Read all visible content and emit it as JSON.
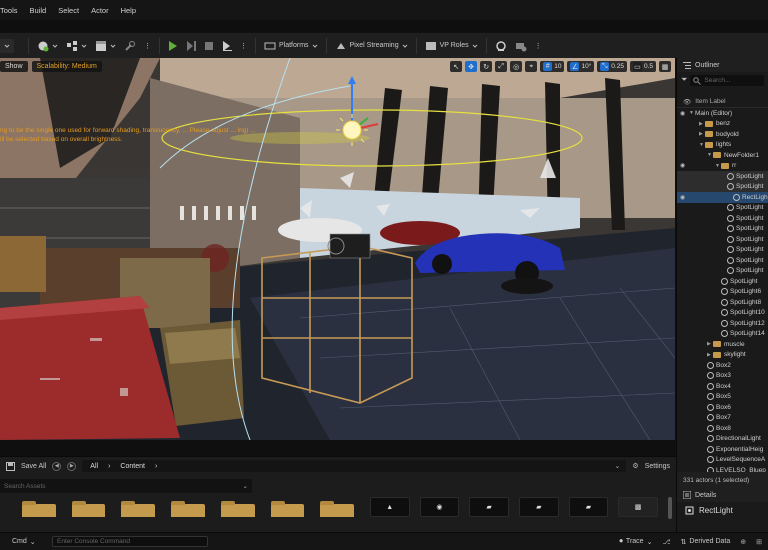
{
  "menu": [
    "Tools",
    "Build",
    "Select",
    "Actor",
    "Help"
  ],
  "toolbar": {
    "platforms": "Platforms",
    "pixel_streaming": "Pixel Streaming",
    "vp_roles": "VP Roles"
  },
  "viewport": {
    "show": "Show",
    "scalability": "Scalability: Medium",
    "warning_line1": "ng to be the single one used for forward shading, translucency, ... Please adjust ... ing) ...",
    "warning_line2": "ill be selected based on overall brightness.",
    "grid_size": "10",
    "rotation_snap": "10°",
    "scale_snap": "0.25",
    "camera_speed": "0.5"
  },
  "outliner": {
    "title": "Outliner",
    "search_placeholder": "Search...",
    "header": "Item Label",
    "rows": [
      {
        "label": "Main (Editor)",
        "indent": 12,
        "kind": "map"
      },
      {
        "label": "benz",
        "indent": 22,
        "kind": "folder"
      },
      {
        "label": "bodyold",
        "indent": 22,
        "kind": "folder"
      },
      {
        "label": "lights",
        "indent": 22,
        "kind": "folder-open"
      },
      {
        "label": "NewFolder1",
        "indent": 30,
        "kind": "folder-open"
      },
      {
        "label": "rr",
        "indent": 38,
        "kind": "folder-open"
      },
      {
        "label": "SpotLight",
        "indent": 50,
        "kind": "light"
      },
      {
        "label": "SpotLight",
        "indent": 50,
        "kind": "light"
      },
      {
        "label": "RectLigh",
        "indent": 56,
        "kind": "light"
      },
      {
        "label": "SpotLight",
        "indent": 50,
        "kind": "light"
      },
      {
        "label": "SpotLight",
        "indent": 50,
        "kind": "light"
      },
      {
        "label": "SpotLight",
        "indent": 50,
        "kind": "light"
      },
      {
        "label": "SpotLight",
        "indent": 50,
        "kind": "light"
      },
      {
        "label": "SpotLight",
        "indent": 50,
        "kind": "light"
      },
      {
        "label": "SpotLight",
        "indent": 50,
        "kind": "light"
      },
      {
        "label": "SpotLight",
        "indent": 50,
        "kind": "light"
      },
      {
        "label": "SpotLight",
        "indent": 44,
        "kind": "light"
      },
      {
        "label": "SpotLight6",
        "indent": 44,
        "kind": "light"
      },
      {
        "label": "SpotLight8",
        "indent": 44,
        "kind": "light"
      },
      {
        "label": "SpotLight10",
        "indent": 44,
        "kind": "light"
      },
      {
        "label": "SpotLight12",
        "indent": 44,
        "kind": "light"
      },
      {
        "label": "SpotLight14",
        "indent": 44,
        "kind": "light"
      },
      {
        "label": "muscle",
        "indent": 30,
        "kind": "folder"
      },
      {
        "label": "skylight",
        "indent": 30,
        "kind": "folder"
      },
      {
        "label": "Box2",
        "indent": 30,
        "kind": "box"
      },
      {
        "label": "Box3",
        "indent": 30,
        "kind": "box"
      },
      {
        "label": "Box4",
        "indent": 30,
        "kind": "box"
      },
      {
        "label": "Box5",
        "indent": 30,
        "kind": "box"
      },
      {
        "label": "Box6",
        "indent": 30,
        "kind": "box"
      },
      {
        "label": "Box7",
        "indent": 30,
        "kind": "box"
      },
      {
        "label": "Box8",
        "indent": 30,
        "kind": "box"
      },
      {
        "label": "DirectionalLight",
        "indent": 30,
        "kind": "light"
      },
      {
        "label": "ExponentialHeig",
        "indent": 30,
        "kind": "box"
      },
      {
        "label": "LevelSequenceA",
        "indent": 30,
        "kind": "box"
      },
      {
        "label": "LEVELSQ_Bluep",
        "indent": 30,
        "kind": "box"
      }
    ],
    "footer": "331 actors (1 selected)"
  },
  "details": {
    "title": "Details",
    "object": "RectLight"
  },
  "content_browser": {
    "save_all": "Save All",
    "path_all": "All",
    "path_content": "Content",
    "settings": "Settings",
    "search_placeholder": "Search Assets"
  },
  "statusbar": {
    "cmd": "Cmd",
    "console_placeholder": "Enter Console Command",
    "trace": "Trace",
    "derived_data": "Derived Data"
  },
  "colors": {
    "accent_blue": "#1f6ecb",
    "warning_orange": "#e49b1e",
    "folder": "#c49a4c",
    "play_green": "#5fb036"
  }
}
